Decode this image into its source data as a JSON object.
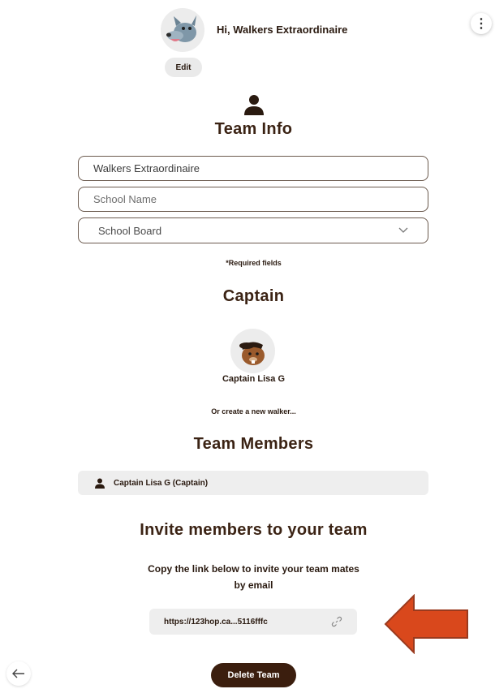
{
  "header": {
    "greeting": "Hi, Walkers Extraordinaire",
    "edit_label": "Edit",
    "menu_glyph": "⋮"
  },
  "team_info": {
    "title": "Team Info",
    "team_name_value": "Walkers Extraordinaire",
    "school_name_placeholder": "School Name",
    "school_board_selected": "School Board",
    "required_note": "*Required fields"
  },
  "captain": {
    "title": "Captain",
    "name": "Captain Lisa G",
    "create_new": "Or create a new walker..."
  },
  "members": {
    "title": "Team Members",
    "items": [
      {
        "label": "Captain Lisa G (Captain)"
      }
    ]
  },
  "invite": {
    "title": "Invite members to your team",
    "description": "Copy the link below to invite your team mates by email",
    "link_text": "https://123hop.ca...5116fffc"
  },
  "footer": {
    "delete_label": "Delete Team"
  },
  "colors": {
    "brand_brown": "#3b1e0e",
    "arrow_fill": "#d9481c",
    "arrow_stroke": "#9a3a1e",
    "field_border": "#6b5a4e",
    "pill_gray": "#eeeeee"
  },
  "icons": {
    "menu": "kebab-menu-icon",
    "person": "person-icon",
    "chevron": "chevron-down-icon",
    "link": "link-icon",
    "back": "arrow-left-icon"
  }
}
